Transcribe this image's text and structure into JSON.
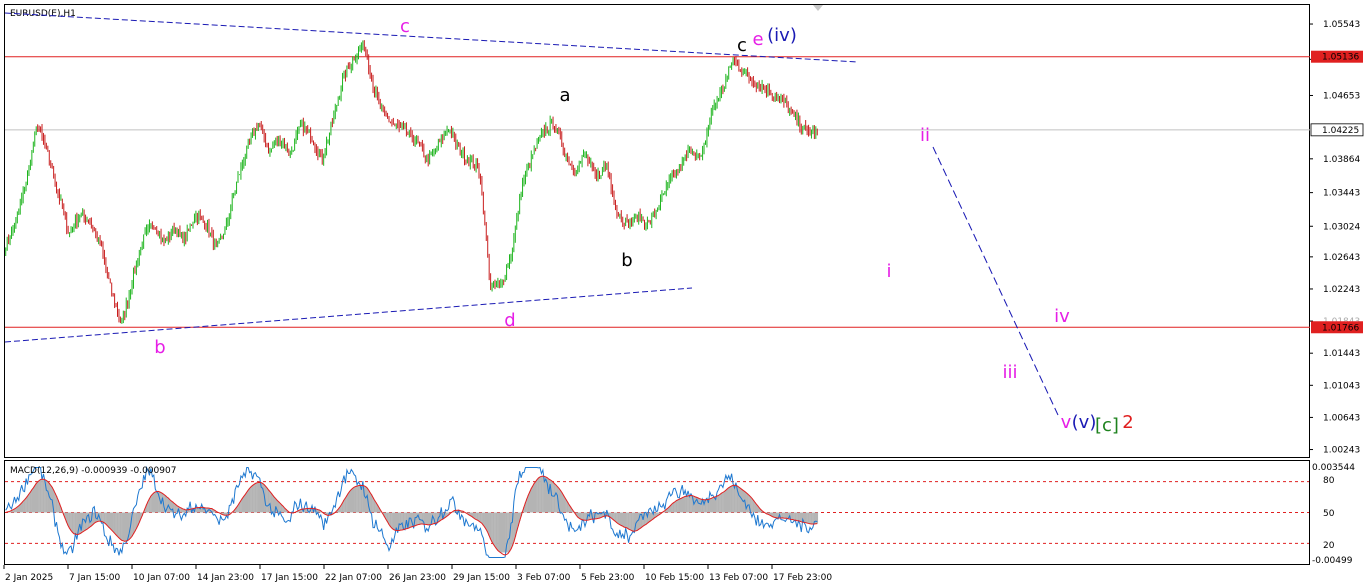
{
  "window": {
    "title": "EURUSD(E),H1",
    "collapse_arrow": "triangle-down-icon"
  },
  "price_axis": {
    "ticks": [
      "1.05543",
      "1.05103",
      "1.04653",
      "1.04225",
      "1.03864",
      "1.03443",
      "1.03024",
      "1.02643",
      "1.02243",
      "1.01843",
      "1.01766",
      "1.01443",
      "1.01043",
      "1.00643",
      "1.00243"
    ],
    "ylim": [
      1.0015,
      1.0578
    ],
    "current_price": "1.04225",
    "current_price_value": 1.04225,
    "level_high": {
      "label": "1.05136",
      "value": 1.05136,
      "color": "#e02020"
    },
    "level_low": {
      "label": "1.01766",
      "value": 1.01766,
      "color": "#e02020"
    }
  },
  "time_axis": {
    "labels": [
      "2 Jan 2025",
      "7 Jan 15:00",
      "10 Jan 07:00",
      "14 Jan 23:00",
      "17 Jan 15:00",
      "22 Jan 07:00",
      "26 Jan 23:00",
      "29 Jan 15:00",
      "3 Feb 07:00",
      "5 Feb 23:00",
      "10 Feb 15:00",
      "13 Feb 07:00",
      "17 Feb 23:00"
    ]
  },
  "macd": {
    "title": "MACD(12,26,9) -0.000939 -0.000907",
    "axis_labels": [
      "0.003544",
      "80",
      "50",
      "20",
      "-0.00499"
    ],
    "levels": [
      80,
      50,
      20
    ],
    "level_color": "#e02020",
    "line_color": "#1e78d0",
    "signal_color": "#e02020",
    "hist_color": "#b4b4b4"
  },
  "colors": {
    "bull_candle": "#1eb41e",
    "bear_candle": "#c81e1e",
    "trendline": "#1a1ab4",
    "projection": "#1a1ab4",
    "wave_magenta": "#e61ee6",
    "wave_black": "#000000",
    "wave_blue": "#1a1ab4",
    "wave_green": "#1e821e",
    "wave_red": "#e01e1e",
    "current_price_line": "#c0c0c0"
  },
  "wave_labels": [
    {
      "text": "c",
      "color": "magenta"
    },
    {
      "text": "b",
      "color": "magenta"
    },
    {
      "text": "d",
      "color": "magenta"
    },
    {
      "text": "a",
      "color": "black"
    },
    {
      "text": "b",
      "color": "black"
    },
    {
      "text": "c",
      "color": "black"
    },
    {
      "text": "e",
      "color": "magenta"
    },
    {
      "text": "(iv)",
      "color": "blue"
    },
    {
      "text": "ii",
      "color": "magenta"
    },
    {
      "text": "i",
      "color": "magenta"
    },
    {
      "text": "iii",
      "color": "magenta"
    },
    {
      "text": "iv",
      "color": "magenta"
    },
    {
      "text": "v",
      "color": "magenta"
    },
    {
      "text": "(v)",
      "color": "blue"
    },
    {
      "text": "[c]",
      "color": "green"
    },
    {
      "text": "2",
      "color": "red"
    }
  ],
  "chart_data": {
    "type": "line",
    "series": [
      {
        "values": [
          1.0278,
          1.0308,
          1.0362,
          1.043,
          1.0392,
          1.0342,
          1.0292,
          1.0318,
          1.0308,
          1.0278,
          1.0222,
          1.018,
          1.0235,
          1.0285,
          1.0308,
          1.0282,
          1.03,
          1.0285,
          1.0318,
          1.0305,
          1.0275,
          1.0305,
          1.0362,
          1.0402,
          1.0432,
          1.0395,
          1.0412,
          1.0392,
          1.0428,
          1.0415,
          1.0385,
          1.0432,
          1.0488,
          1.0512,
          1.053,
          1.047,
          1.0438,
          1.0428,
          1.0418,
          1.0408,
          1.0385,
          1.0402,
          1.0425,
          1.0398,
          1.0385,
          1.037,
          1.0225,
          1.023,
          1.0268,
          1.0355,
          1.0392,
          1.042,
          1.0432,
          1.0395,
          1.0372,
          1.0392,
          1.0362,
          1.038,
          1.032,
          1.0305,
          1.0315,
          1.0305,
          1.033,
          1.0358,
          1.0375,
          1.04,
          1.0385,
          1.0448,
          1.0472,
          1.051,
          1.0495,
          1.0482,
          1.0475,
          1.0465,
          1.0455,
          1.0435,
          1.042,
          1.0418
        ]
      }
    ],
    "annotations": [
      "c",
      "b",
      "d",
      "a",
      "b",
      "c",
      "e",
      "(iv)",
      "ii",
      "i",
      "iii",
      "iv",
      "v",
      "(v)",
      "[c]",
      "2"
    ]
  }
}
